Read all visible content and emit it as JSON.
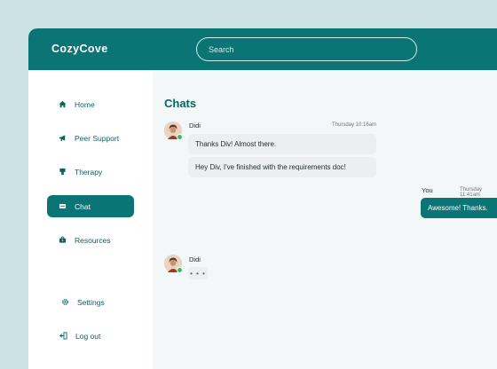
{
  "app": {
    "title": "CozyCove"
  },
  "search": {
    "placeholder": "Search"
  },
  "sidebar": {
    "items": [
      {
        "label": "Home",
        "icon": "home-icon",
        "active": false
      },
      {
        "label": "Peer Support",
        "icon": "megaphone-icon",
        "active": false
      },
      {
        "label": "Therapy",
        "icon": "couch-icon",
        "active": false
      },
      {
        "label": "Chat",
        "icon": "chat-icon",
        "active": true
      },
      {
        "label": "Resources",
        "icon": "toolbox-icon",
        "active": false
      }
    ],
    "bottom": [
      {
        "label": "Settings",
        "icon": "gear-icon"
      },
      {
        "label": "Log out",
        "icon": "logout-icon"
      }
    ]
  },
  "main": {
    "title": "Chats",
    "messages": [
      {
        "sender": "Didi",
        "time": "Thursday 10:16am",
        "lines": [
          "Thanks Div! Almost there.",
          "Hey Div, I've finished with the requirements doc!"
        ]
      },
      {
        "sender": "You",
        "time": "Thursday 11:41am",
        "lines": [
          "Awesome! Thanks."
        ]
      },
      {
        "sender": "Didi",
        "typing": "• • •"
      }
    ]
  },
  "colors": {
    "brand": "#0b7474",
    "background": "#cde3e3",
    "online": "#2fbf60"
  }
}
